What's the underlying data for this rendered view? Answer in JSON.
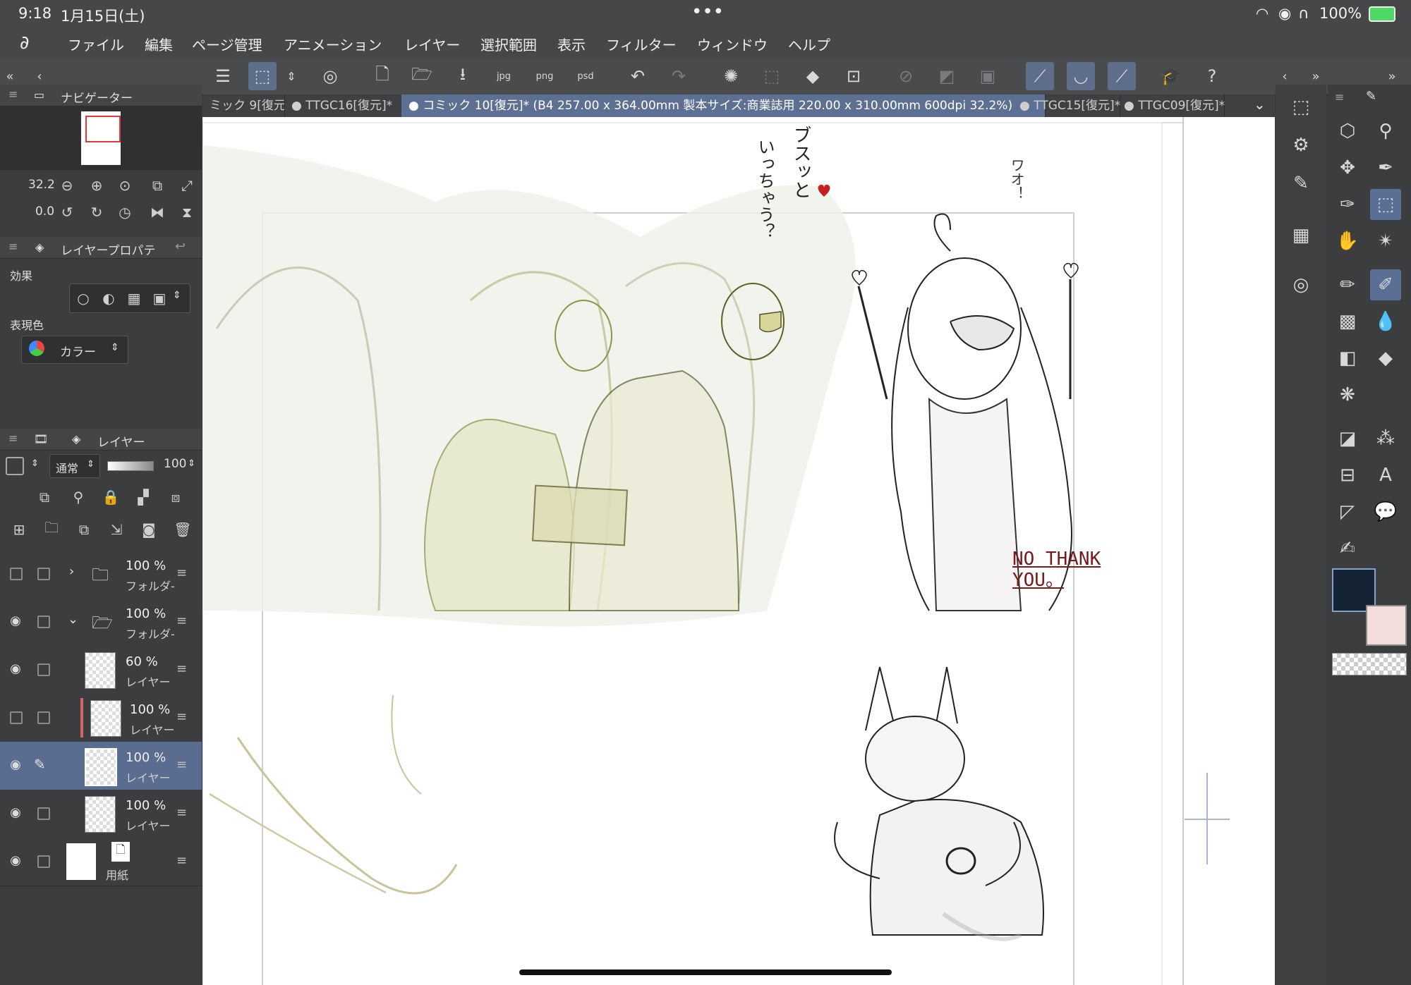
{
  "status": {
    "time": "9:18",
    "date": "1月15日(土)",
    "battery": "100%",
    "dots": "•••"
  },
  "menu": [
    "ファイル",
    "編集",
    "ページ管理",
    "アニメーション",
    "レイヤー",
    "選択範囲",
    "表示",
    "フィルター",
    "ウィンドウ",
    "ヘルプ"
  ],
  "tabs": [
    {
      "label": "ミック 9[復元"
    },
    {
      "label": "● TTGC16[復元]*"
    },
    {
      "label": "● コミック 10[復元]* (B4 257.00 x 364.00mm 製本サイズ:商業誌用 220.00 x 310.00mm 600dpi 32.2%)"
    },
    {
      "label": "● TTGC15[復元]*"
    },
    {
      "label": "● TTGC09[復元]*"
    }
  ],
  "navigator": {
    "title": "ナビゲーター",
    "zoom": "32.2",
    "rotation": "0.0"
  },
  "layer_property": {
    "title": "レイヤープロパテ",
    "effect_label": "効果",
    "color_label": "表現色",
    "color_value": "カラー"
  },
  "layers_panel": {
    "title": "レイヤー",
    "blend_mode": "通常",
    "opacity": "100",
    "rows": [
      {
        "pct": "100 %",
        "name": "フォルダ-",
        "visible": false,
        "type": "folder-closed"
      },
      {
        "pct": "100 %",
        "name": "フォルダ-",
        "visible": true,
        "type": "folder-open"
      },
      {
        "pct": "60 %",
        "name": "レイヤー",
        "visible": true,
        "type": "layer"
      },
      {
        "pct": "100 %",
        "name": "レイヤー",
        "visible": false,
        "type": "layer"
      },
      {
        "pct": "100 %",
        "name": "レイヤー",
        "visible": true,
        "type": "layer",
        "selected": true
      },
      {
        "pct": "100 %",
        "name": "レイヤー",
        "visible": true,
        "type": "layer"
      },
      {
        "pct": "",
        "name": "用紙",
        "visible": true,
        "type": "paper"
      }
    ]
  },
  "canvas_text": {
    "sfx1": "ブスッと",
    "sfx2": "いっちゃう？",
    "sfx3": "ワオ！",
    "speech": "NO THANK YOU。"
  },
  "colors": {
    "main": "#152433",
    "sub": "#f2dcdc",
    "accent": "#5d6f93"
  }
}
